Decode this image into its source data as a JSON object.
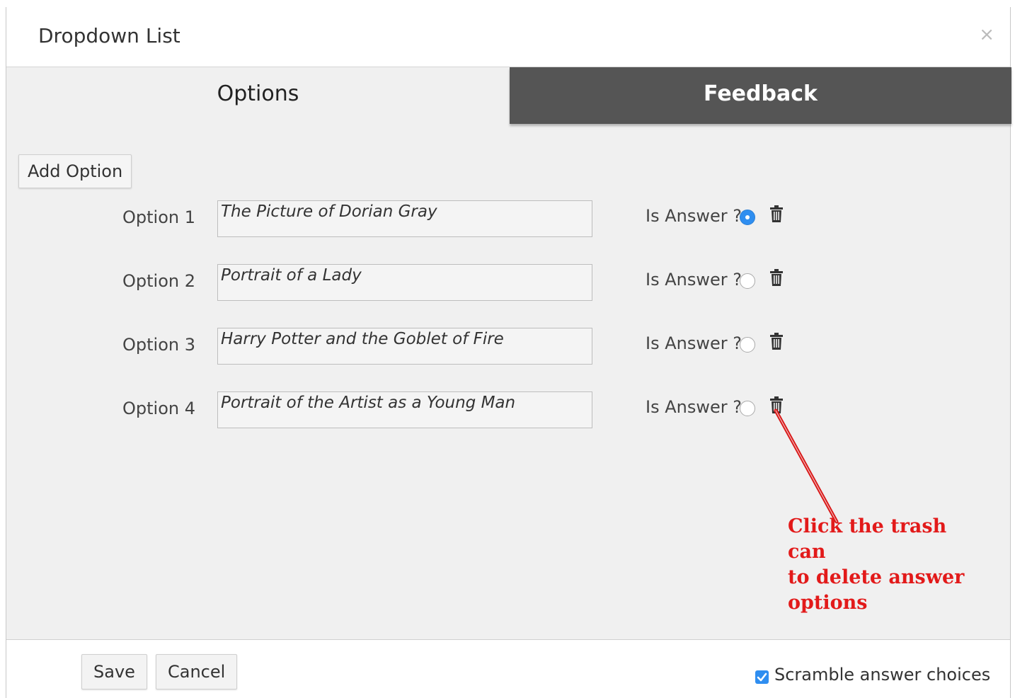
{
  "dialog": {
    "title": "Dropdown List",
    "close_glyph": "×"
  },
  "tabs": [
    {
      "label": "Options",
      "active": true
    },
    {
      "label": "Feedback",
      "active": false
    }
  ],
  "add_option_label": "Add Option",
  "options": [
    {
      "label": "Option 1",
      "value": "The Picture of Dorian Gray",
      "is_answer_label": "Is Answer ?",
      "is_answer": true
    },
    {
      "label": "Option 2",
      "value": "Portrait of a Lady",
      "is_answer_label": "Is Answer ?",
      "is_answer": false
    },
    {
      "label": "Option 3",
      "value": "Harry Potter and the Goblet of Fire",
      "is_answer_label": "Is Answer ?",
      "is_answer": false
    },
    {
      "label": "Option 4",
      "value": "Portrait of the Artist as a Young Man",
      "is_answer_label": "Is Answer ?",
      "is_answer": false
    }
  ],
  "annotation": {
    "lines": [
      "Click the trash can",
      "to delete answer",
      "options"
    ],
    "color": "#e21a1a"
  },
  "footer": {
    "save_label": "Save",
    "cancel_label": "Cancel",
    "scramble_label": "Scramble answer choices",
    "scramble_checked": true
  },
  "colors": {
    "accent": "#2f8ef0",
    "inactive_tab": "#555555",
    "body_bg": "#f0f0f0"
  },
  "icons": {
    "close": "close-icon",
    "trash": "trash-icon",
    "radio": "radio-button",
    "checkbox": "checkbox-icon"
  }
}
